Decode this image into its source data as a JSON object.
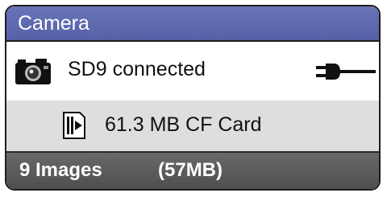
{
  "header": {
    "title": "Camera"
  },
  "device": {
    "label": "SD9 connected",
    "icon": "camera-icon",
    "status_icon": "plug-icon"
  },
  "storage": {
    "label": "61.3 MB CF Card",
    "icon": "memory-card-icon"
  },
  "footer": {
    "image_count": "9 Images",
    "total_size": "(57MB)"
  },
  "colors": {
    "header_bg": "#5d67ac",
    "footer_bg": "#5a5a5a",
    "card_row_bg": "#dedede",
    "border": "#1e1e1e"
  }
}
